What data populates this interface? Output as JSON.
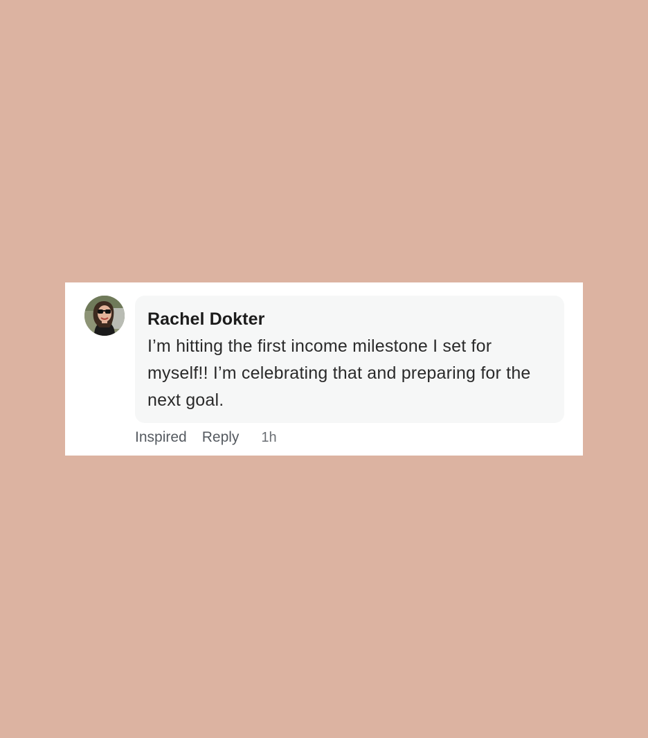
{
  "comment": {
    "author": "Rachel Dokter",
    "message": "I’m hitting the first income milestone I set for myself!! I’m celebrating that and preparing for the next goal.",
    "avatar_icon": "user-avatar-photo",
    "actions": {
      "inspired_label": "Inspired",
      "reply_label": "Reply",
      "timestamp": "1h"
    }
  },
  "colors": {
    "page_background": "#dcb3a1",
    "card_background": "#ffffff",
    "bubble_background": "#f6f7f7",
    "author_text": "#1c1c1c",
    "action_text": "#555a60"
  }
}
